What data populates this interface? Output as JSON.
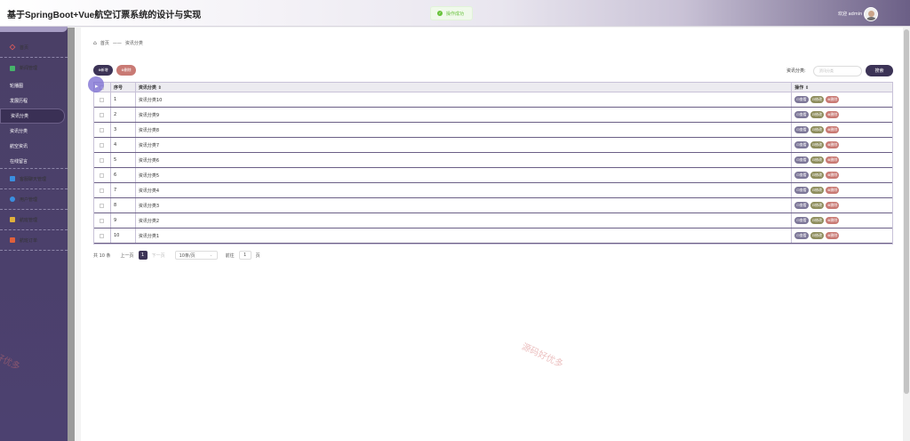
{
  "app": {
    "title": "基于SpringBoot+Vue航空订票系统的设计与实现"
  },
  "toast": {
    "message": "操作成功"
  },
  "user": {
    "welcome": "欢迎 admin"
  },
  "sidebar": {
    "items": [
      {
        "label": "首页",
        "icon": "home-icon",
        "color": "#e05a5a"
      },
      {
        "label": "新闻管理",
        "icon": "news-icon",
        "color": "#46b36b"
      },
      {
        "label": "轮播图",
        "sub": true
      },
      {
        "label": "发展历程",
        "sub": true
      },
      {
        "label": "资讯分类",
        "sub": true,
        "active": true
      },
      {
        "label": "资讯分类",
        "sub": true
      },
      {
        "label": "航空资讯",
        "sub": true
      },
      {
        "label": "在线留言",
        "sub": true
      },
      {
        "label": "客服聊天管理",
        "icon": "chat-icon",
        "color": "#3b8fe0"
      },
      {
        "label": "用户管理",
        "icon": "user-icon",
        "color": "#3b8fe0"
      },
      {
        "label": "航班管理",
        "icon": "plane-icon",
        "color": "#e0b03b"
      },
      {
        "label": "航班订单",
        "icon": "order-icon",
        "color": "#e0603b"
      }
    ]
  },
  "breadcrumb": {
    "home": "首页",
    "sep": "——",
    "current": "资讯分类"
  },
  "toolbar": {
    "add": "⊕新增",
    "delete": "⊗删除"
  },
  "search": {
    "label": "资讯分类:",
    "placeholder": "资讯分类",
    "button": "搜索"
  },
  "table": {
    "headers": {
      "no": "序号",
      "name": "资讯分类 ⇕",
      "ops": "操作 ⇕"
    },
    "ops": {
      "view": "⊡查看",
      "edit": "⊡修改",
      "del": "⊗删除"
    },
    "rows": [
      {
        "no": "1",
        "name": "资讯分类10"
      },
      {
        "no": "2",
        "name": "资讯分类9"
      },
      {
        "no": "3",
        "name": "资讯分类8"
      },
      {
        "no": "4",
        "name": "资讯分类7"
      },
      {
        "no": "5",
        "name": "资讯分类6"
      },
      {
        "no": "6",
        "name": "资讯分类5"
      },
      {
        "no": "7",
        "name": "资讯分类4"
      },
      {
        "no": "8",
        "name": "资讯分类3"
      },
      {
        "no": "9",
        "name": "资讯分类2"
      },
      {
        "no": "10",
        "name": "资讯分类1"
      }
    ]
  },
  "pager": {
    "total": "共 10 条",
    "prev": "上一页",
    "page": "1",
    "next": "下一页",
    "size": "10条/页",
    "goto": "前往",
    "jump": "1",
    "unit": "页"
  },
  "watermark": {
    "text": "源码好优多",
    "partial": "好优多"
  }
}
